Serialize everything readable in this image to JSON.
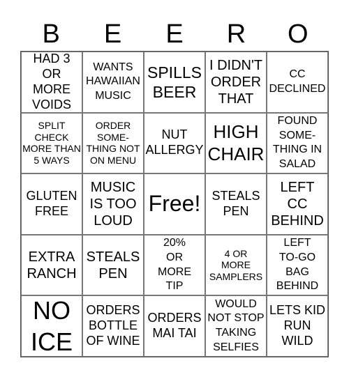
{
  "title_letters": [
    "B",
    "E",
    "E",
    "R",
    "O"
  ],
  "cells": [
    [
      "HAD 3\nOR\nMORE\nVOIDS",
      "WANTS\nHAWAIIAN\nMUSIC",
      "SPILLS\nBEER",
      "I DIDN'T\nORDER\nTHAT",
      "CC\nDECLINED"
    ],
    [
      "SPLIT\nCHECK\nMORE THAN\n5 WAYS",
      "ORDER\nSOME-\nTHING NOT\nON MENU",
      "NUT\nALLERGY",
      "HIGH\nCHAIR",
      "FOUND\nSOME-\nTHING IN\nSALAD"
    ],
    [
      "GLUTEN\nFREE",
      "MUSIC\nIS TOO\nLOUD",
      "Free!",
      "STEALS\nPEN",
      "LEFT\nCC\nBEHIND"
    ],
    [
      "EXTRA\nRANCH",
      "STEALS\nPEN",
      "20%\nOR\nMORE\nTIP",
      "4 OR\nMORE\nSAMPLERS",
      "LEFT\nTO-GO\nBAG\nBEHIND"
    ],
    [
      "NO\nICE",
      "ORDERS\nBOTTLE\nOF WINE",
      "ORDERS\nMAI TAI",
      "WOULD\nNOT STOP\nTAKING\nSELFIES",
      "LETS KID\nRUN\nWILD"
    ]
  ]
}
